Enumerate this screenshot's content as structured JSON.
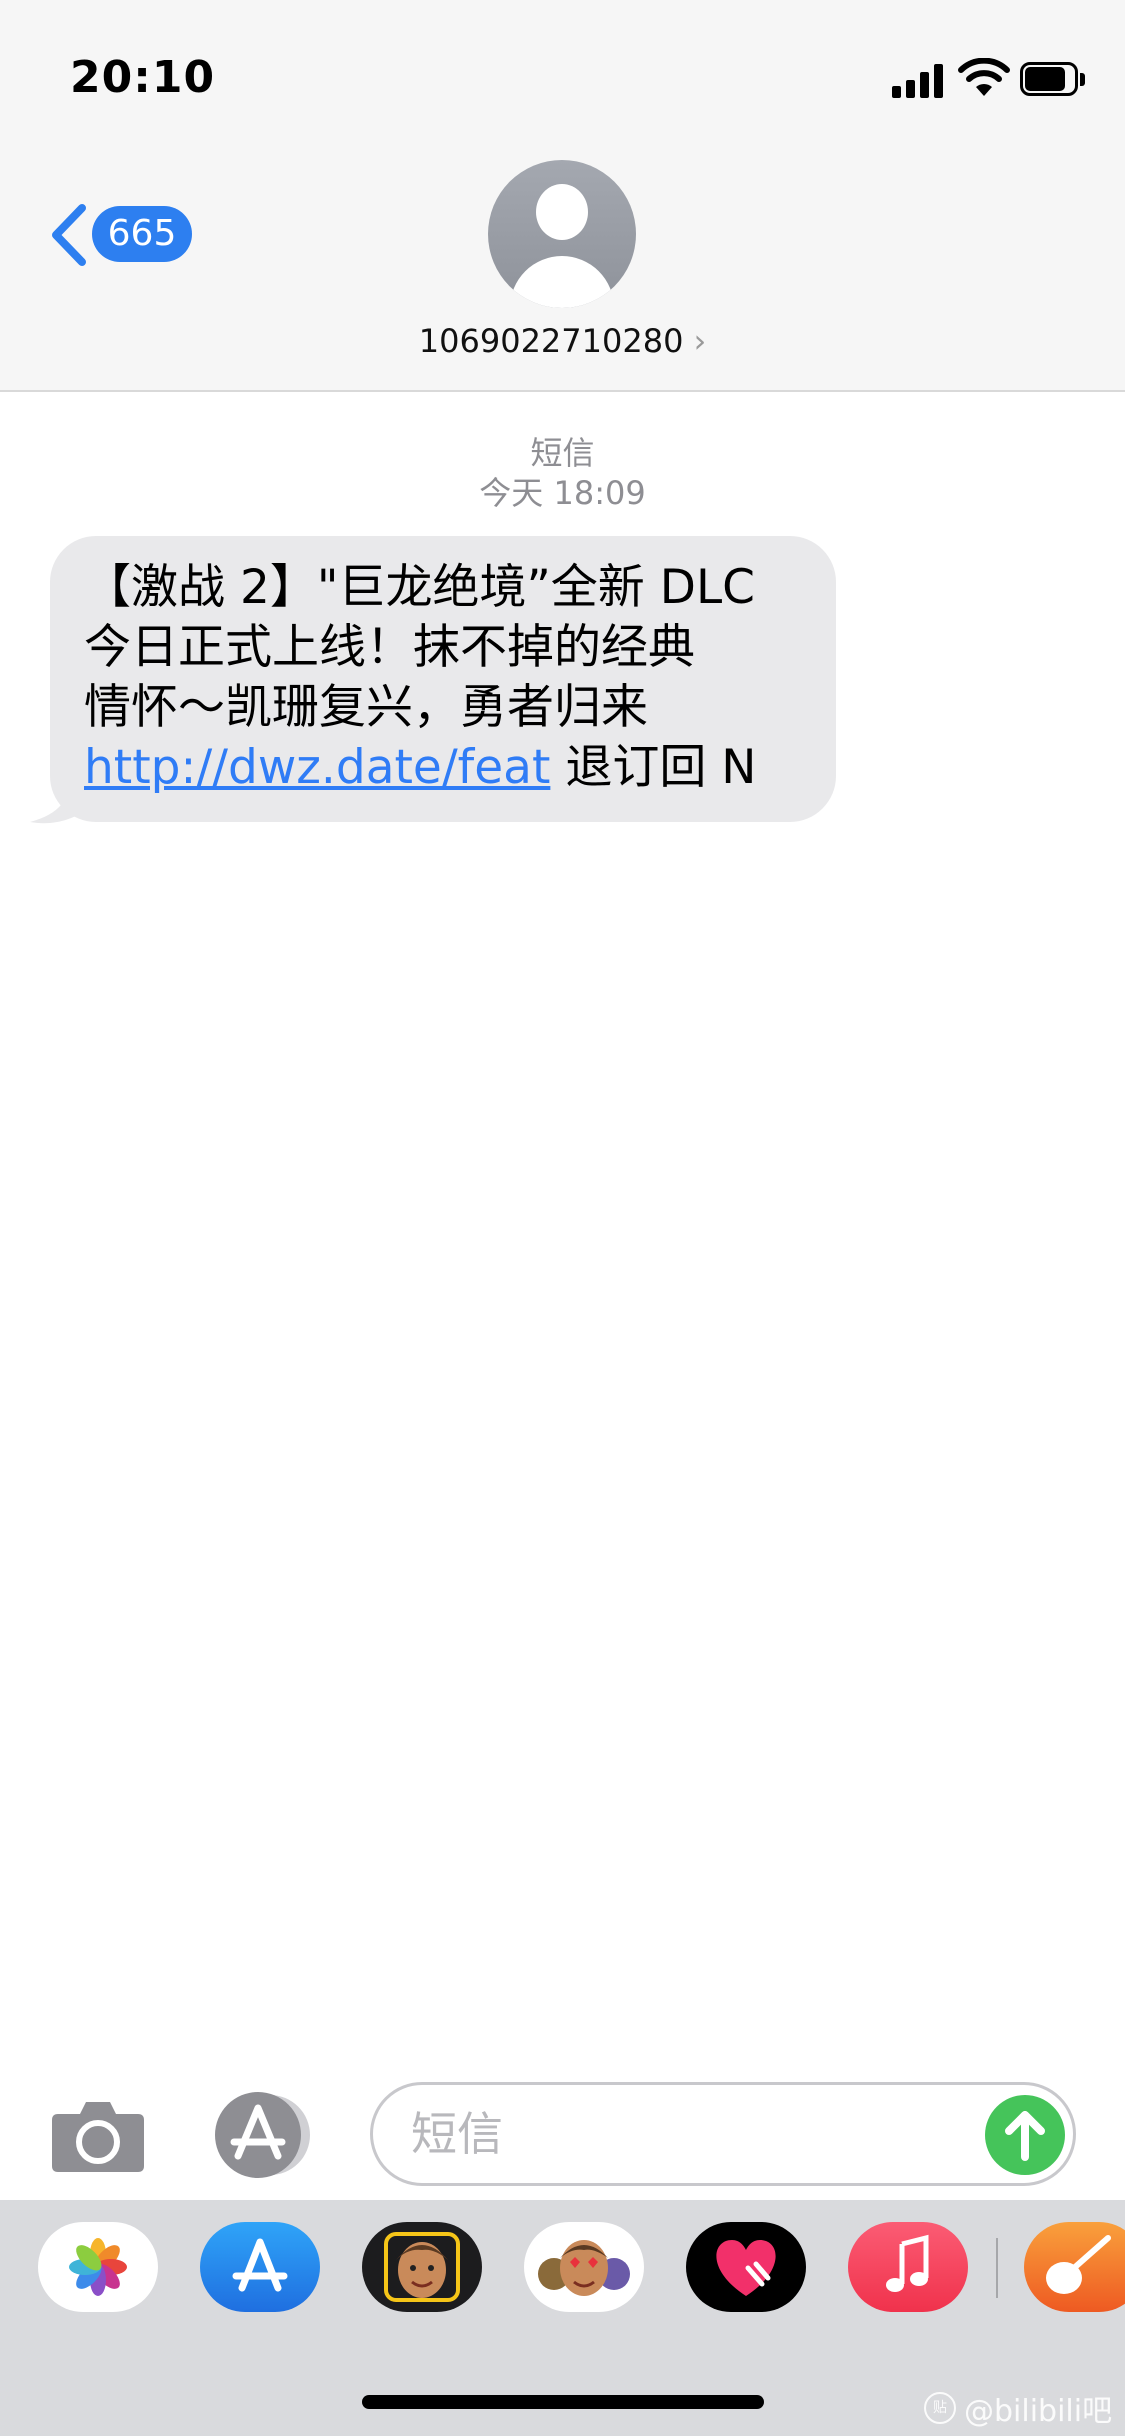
{
  "status_bar": {
    "time": "20:10"
  },
  "nav": {
    "back_count": "665",
    "contact_number": "1069022710280",
    "chevron": "›"
  },
  "conversation": {
    "service_label": "短信",
    "timestamp": "今天 18:09",
    "messages": [
      {
        "direction": "incoming",
        "lines": [
          "【激战 2】\"巨龙绝境”全新 DLC",
          "今日正式上线！抹不掉的经典",
          "情怀～凯珊复兴，勇者归来"
        ],
        "link": "http://dwz.date/feat",
        "suffix": " 退订回 N"
      }
    ]
  },
  "input_bar": {
    "placeholder": "短信",
    "icons": [
      "camera-icon",
      "app-store-icon",
      "send-arrow-icon"
    ]
  },
  "app_drawer": {
    "apps": [
      "photos-icon",
      "app-store-icon",
      "memoji-camera-icon",
      "animoji-stickers-icon",
      "digital-touch-heart-icon",
      "music-icon",
      "garageband-icon"
    ]
  },
  "watermark": {
    "text": "@bilibili吧",
    "logo_text": "贴"
  },
  "colors": {
    "accent_blue": "#2d7ff0",
    "link_blue": "#2f7cf6",
    "send_green": "#45c45a",
    "bubble_gray": "#e9e9eb",
    "header_bg": "#f6f6f6",
    "drawer_bg": "#d9dadd"
  }
}
